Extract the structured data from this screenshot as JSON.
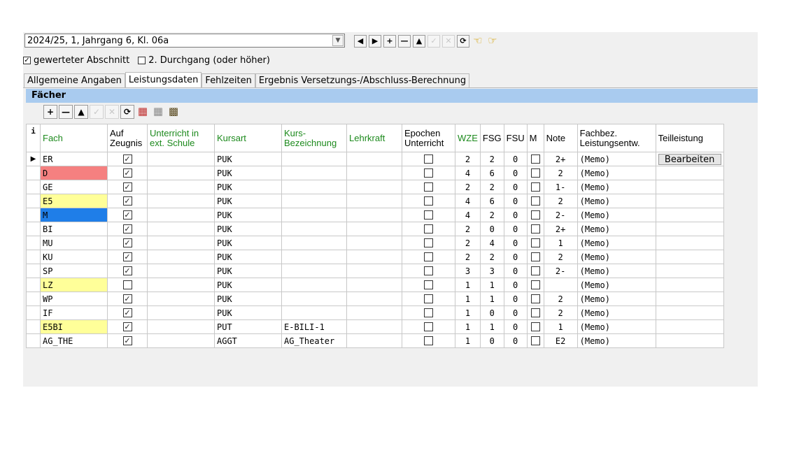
{
  "top": {
    "selector_value": "2024/25, 1, Jahrgang 6, Kl. 06a",
    "nav_icons": [
      "first-arrow",
      "prev-arrow",
      "plus",
      "minus",
      "up-triangle",
      "check",
      "cancel",
      "refresh",
      "hand-left",
      "hand-right"
    ],
    "checkbox1_label": "gewerteter Abschnitt",
    "checkbox1_checked": true,
    "checkbox2_label": "2. Durchgang (oder höher)",
    "checkbox2_checked": false
  },
  "tabs": [
    {
      "label": "Allgemeine Angaben",
      "active": false
    },
    {
      "label": "Leistungsdaten",
      "active": true
    },
    {
      "label": "Fehlzeiten",
      "active": false
    },
    {
      "label": "Ergebnis Versetzungs-/Abschluss-Berechnung",
      "active": false
    }
  ],
  "section": {
    "title": "Fächer"
  },
  "grid": {
    "headers": {
      "info": "i",
      "fach": "Fach",
      "auf_zeugnis": "Auf Zeugnis",
      "unterricht_ext": "Unterricht in ext. Schule",
      "kursart": "Kursart",
      "kurs_bez": "Kurs-Bezeichnung",
      "lehrkraft": "Lehrkraft",
      "epochen": "Epochen Unterricht",
      "wze": "WZE",
      "fsg": "FSG",
      "fsu": "FSU",
      "m": "M",
      "note": "Note",
      "fachbez": "Fachbez. Leistungsentw.",
      "teilleistung": "Teilleistung"
    },
    "teilleistung_button": "Bearbeiten",
    "rows": [
      {
        "fach": "ER",
        "color": "#ffffff",
        "zeugnis": true,
        "kursart": "PUK",
        "kursbez": "",
        "wze": "2",
        "fsg": "2",
        "fsu": "0",
        "note": "2+",
        "memo": "(Memo)",
        "current": true
      },
      {
        "fach": "D",
        "color": "#f58080",
        "zeugnis": true,
        "kursart": "PUK",
        "kursbez": "",
        "wze": "4",
        "fsg": "6",
        "fsu": "0",
        "note": "2",
        "memo": "(Memo)"
      },
      {
        "fach": "GE",
        "color": "#ffffff",
        "zeugnis": true,
        "kursart": "PUK",
        "kursbez": "",
        "wze": "2",
        "fsg": "2",
        "fsu": "0",
        "note": "1-",
        "memo": "(Memo)"
      },
      {
        "fach": "E5",
        "color": "#ffff99",
        "zeugnis": true,
        "kursart": "PUK",
        "kursbez": "",
        "wze": "4",
        "fsg": "6",
        "fsu": "0",
        "note": "2",
        "memo": "(Memo)"
      },
      {
        "fach": "M",
        "color": "#1f7ee8",
        "zeugnis": true,
        "kursart": "PUK",
        "kursbez": "",
        "wze": "4",
        "fsg": "2",
        "fsu": "0",
        "note": "2-",
        "memo": "(Memo)"
      },
      {
        "fach": "BI",
        "color": "#ffffff",
        "zeugnis": true,
        "kursart": "PUK",
        "kursbez": "",
        "wze": "2",
        "fsg": "0",
        "fsu": "0",
        "note": "2+",
        "memo": "(Memo)"
      },
      {
        "fach": "MU",
        "color": "#ffffff",
        "zeugnis": true,
        "kursart": "PUK",
        "kursbez": "",
        "wze": "2",
        "fsg": "4",
        "fsu": "0",
        "note": "1",
        "memo": "(Memo)"
      },
      {
        "fach": "KU",
        "color": "#ffffff",
        "zeugnis": true,
        "kursart": "PUK",
        "kursbez": "",
        "wze": "2",
        "fsg": "2",
        "fsu": "0",
        "note": "2",
        "memo": "(Memo)"
      },
      {
        "fach": "SP",
        "color": "#ffffff",
        "zeugnis": true,
        "kursart": "PUK",
        "kursbez": "",
        "wze": "3",
        "fsg": "3",
        "fsu": "0",
        "note": "2-",
        "memo": "(Memo)"
      },
      {
        "fach": "LZ",
        "color": "#ffff99",
        "zeugnis": false,
        "kursart": "PUK",
        "kursbez": "",
        "wze": "1",
        "fsg": "1",
        "fsu": "0",
        "note": "",
        "memo": "(Memo)"
      },
      {
        "fach": "WP",
        "color": "#ffffff",
        "zeugnis": true,
        "kursart": "PUK",
        "kursbez": "",
        "wze": "1",
        "fsg": "1",
        "fsu": "0",
        "note": "2",
        "memo": "(Memo)"
      },
      {
        "fach": "IF",
        "color": "#ffffff",
        "zeugnis": true,
        "kursart": "PUK",
        "kursbez": "",
        "wze": "1",
        "fsg": "0",
        "fsu": "0",
        "note": "2",
        "memo": "(Memo)"
      },
      {
        "fach": "E5BI",
        "color": "#ffff99",
        "zeugnis": true,
        "kursart": "PUT",
        "kursbez": "E-BILI-1",
        "wze": "1",
        "fsg": "1",
        "fsu": "0",
        "note": "1",
        "memo": "(Memo)"
      },
      {
        "fach": "AG_THE",
        "color": "#ffffff",
        "zeugnis": true,
        "kursart": "AGGT",
        "kursbez": "AG_Theater",
        "wze": "1",
        "fsg": "0",
        "fsu": "0",
        "note": "E2",
        "memo": "(Memo)"
      }
    ]
  }
}
